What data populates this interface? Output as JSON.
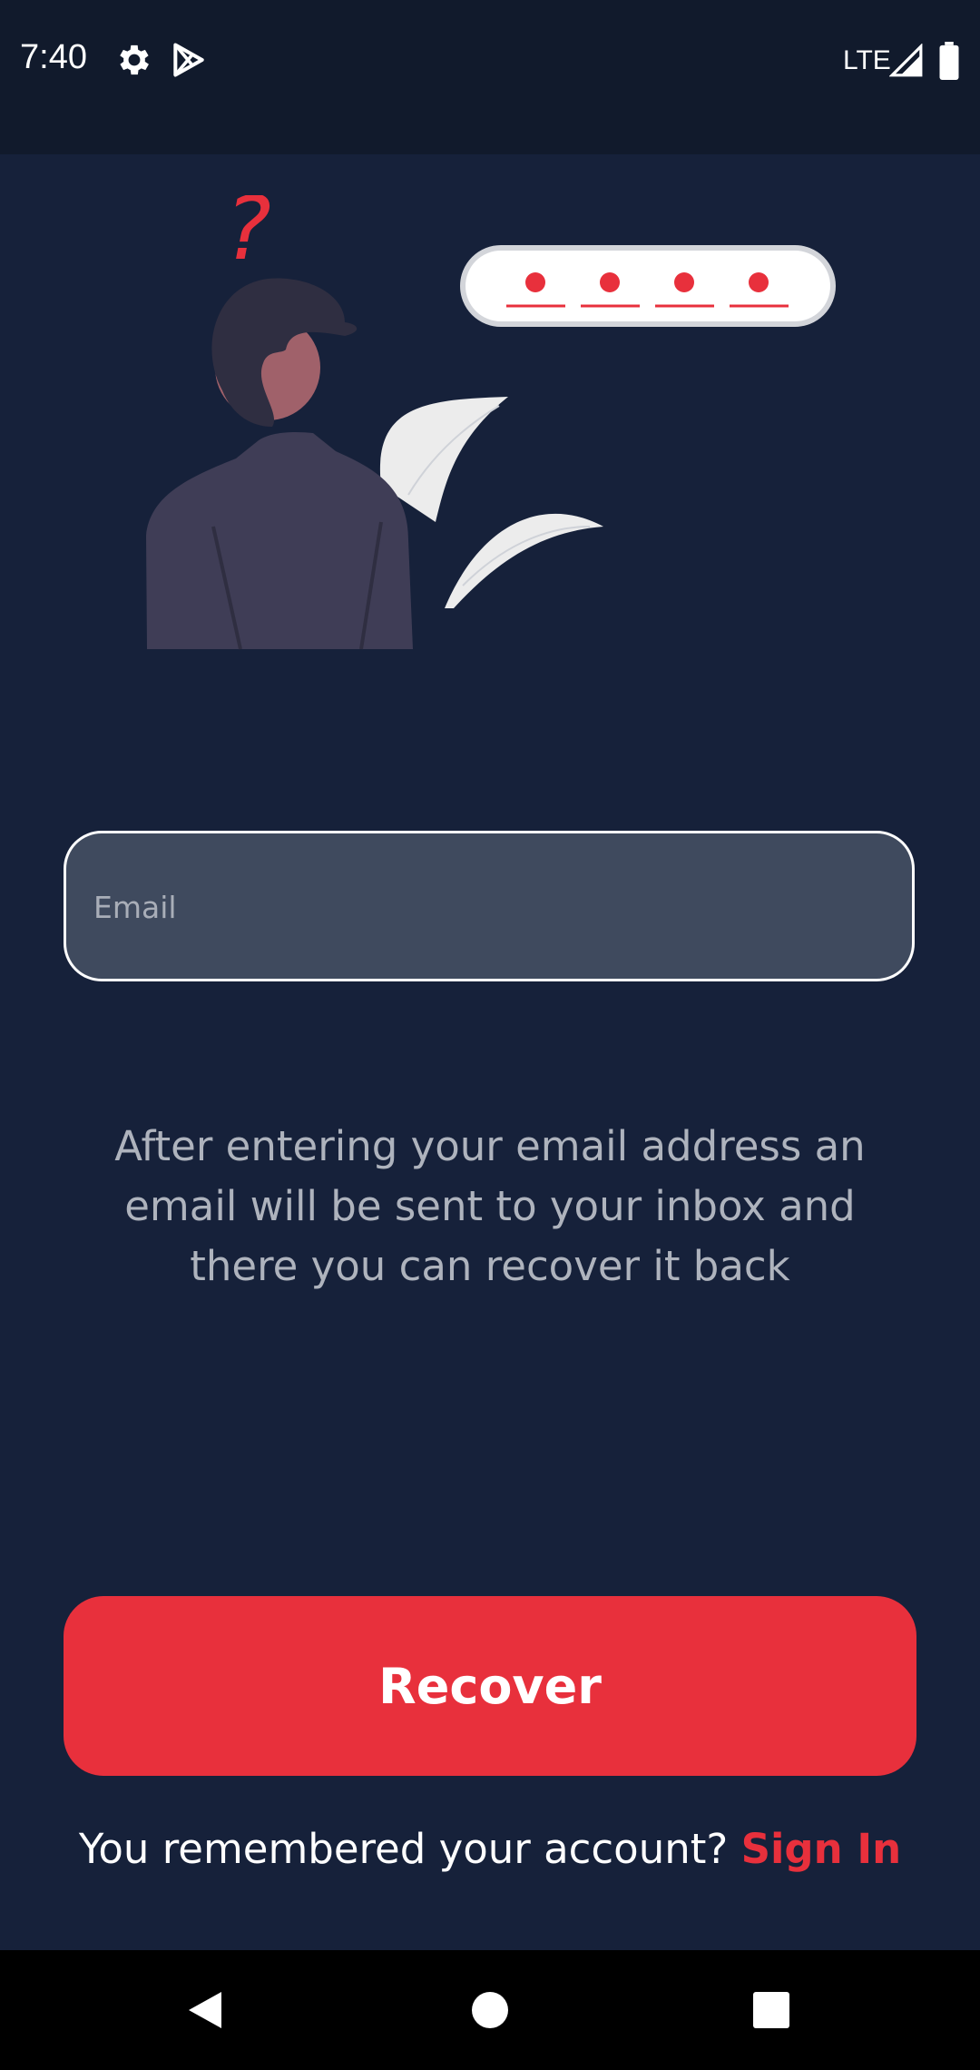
{
  "status_bar": {
    "time": "7:40",
    "network": "LTE",
    "icons": [
      "gear-icon",
      "play-store-icon",
      "signal-icon",
      "battery-icon"
    ]
  },
  "illustration": {
    "question_mark": "?",
    "accent_color": "#e8303c"
  },
  "form": {
    "email_placeholder": "Email",
    "email_value": ""
  },
  "description": "After entering your email address an email will be sent to your inbox and there you can recover it back",
  "recover_button": {
    "label": "Recover"
  },
  "signin": {
    "prompt": "You remembered your account?",
    "link": "Sign In"
  },
  "nav": {
    "icons": [
      "back-icon",
      "home-icon",
      "recents-icon"
    ]
  },
  "colors": {
    "background": "#16213a",
    "status_bar": "#111a2c",
    "accent": "#e8303c",
    "input_fill": "#3f4a5e",
    "muted_text": "#aeb3bd"
  }
}
